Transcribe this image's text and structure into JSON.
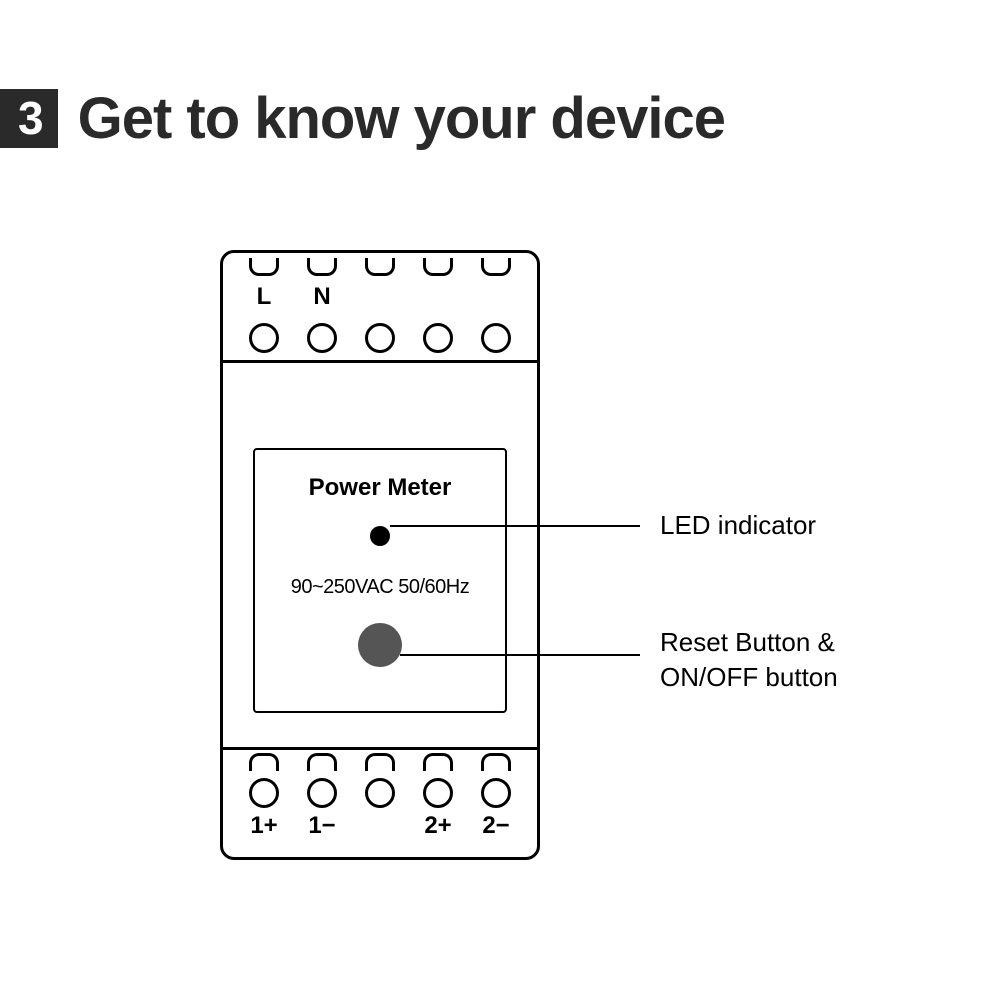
{
  "section": {
    "number": "3",
    "title": "Get to know your device"
  },
  "device": {
    "top_labels": {
      "L": "L",
      "N": "N"
    },
    "panel_title": "Power Meter",
    "spec": "90~250VAC 50/60Hz",
    "bottom_labels": {
      "one_plus": "1+",
      "one_minus": "1−",
      "two_plus": "2+",
      "two_minus": "2−"
    }
  },
  "callouts": {
    "led": "LED indicator",
    "reset_line1": "Reset Button &",
    "reset_line2": "ON/OFF button"
  }
}
